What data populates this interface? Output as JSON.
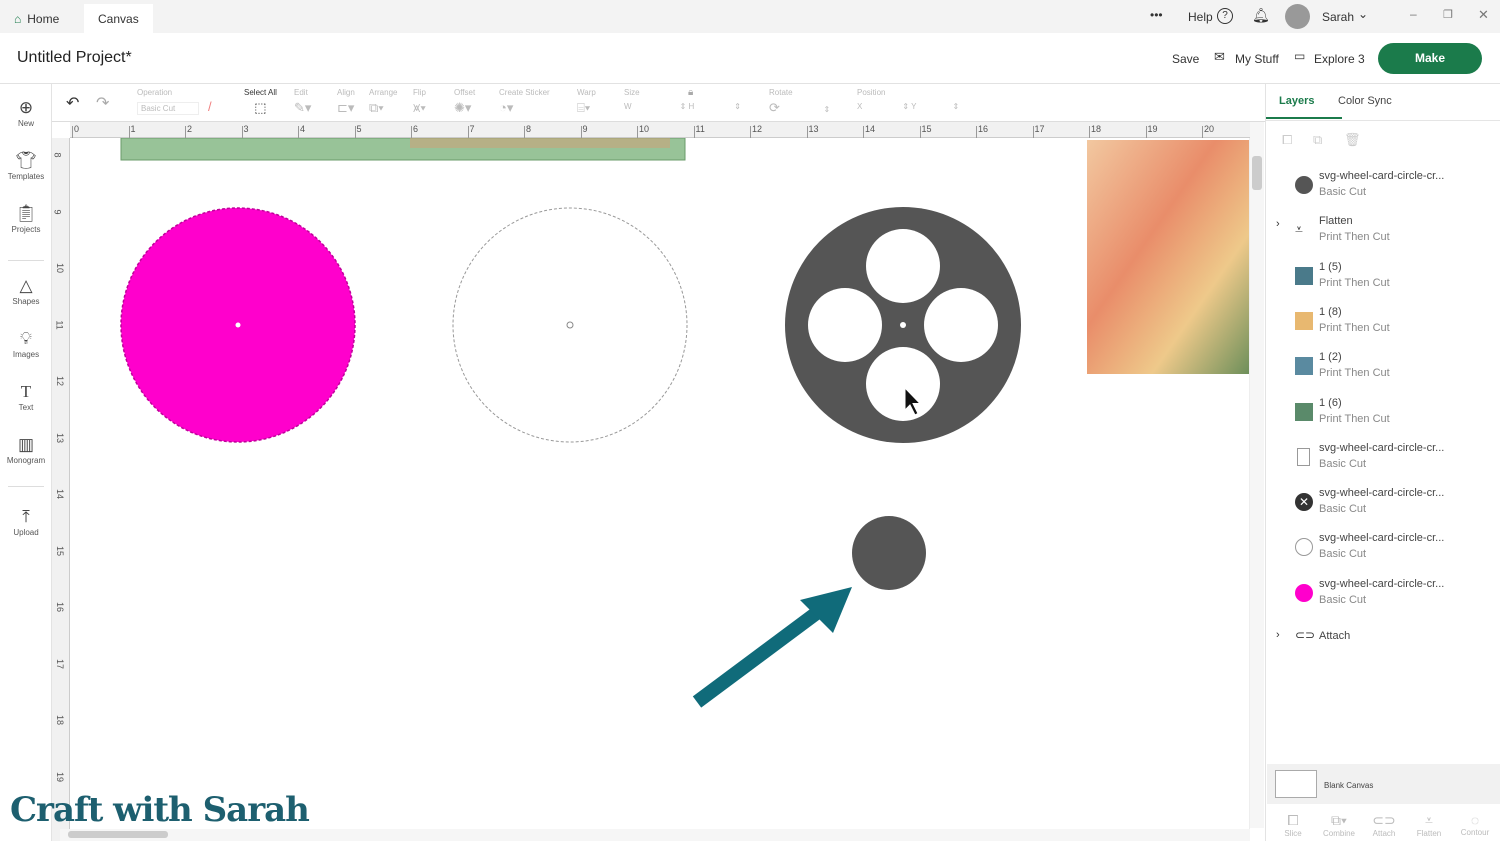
{
  "topbar": {
    "tabs": [
      {
        "label": "Home"
      },
      {
        "label": "Canvas"
      }
    ],
    "more": "•••",
    "help": "Help",
    "user": "Sarah"
  },
  "project": {
    "title": "Untitled Project*",
    "save": "Save",
    "my_stuff": "My Stuff",
    "machine": "Explore 3",
    "make": "Make"
  },
  "toolbar": {
    "operation_label": "Operation",
    "operation_value": "Basic Cut",
    "select_all": "Select All",
    "edit": "Edit",
    "align": "Align",
    "arrange": "Arrange",
    "flip": "Flip",
    "offset": "Offset",
    "create_sticker": "Create Sticker",
    "warp": "Warp",
    "size": "Size",
    "w": "W",
    "h": "H",
    "rotate": "Rotate",
    "position": "Position",
    "x": "X",
    "y": "Y"
  },
  "sidebar": {
    "items": [
      {
        "label": "New",
        "icon": "plus-circle-icon"
      },
      {
        "label": "Templates",
        "icon": "shirt-icon"
      },
      {
        "label": "Projects",
        "icon": "clipboard-icon"
      },
      {
        "label": "Shapes",
        "icon": "shapes-icon"
      },
      {
        "label": "Images",
        "icon": "bulb-icon"
      },
      {
        "label": "Text",
        "icon": "text-icon"
      },
      {
        "label": "Monogram",
        "icon": "monogram-icon"
      },
      {
        "label": "Upload",
        "icon": "upload-icon"
      }
    ]
  },
  "ruler": {
    "h": [
      "0",
      "1",
      "2",
      "3",
      "4",
      "5",
      "6",
      "7",
      "8",
      "9",
      "10",
      "11",
      "12",
      "13",
      "14",
      "15",
      "16",
      "17",
      "18",
      "19",
      "20"
    ],
    "v": [
      "8",
      "9",
      "10",
      "11",
      "12",
      "13",
      "14",
      "15",
      "16",
      "17",
      "18",
      "19"
    ]
  },
  "panel": {
    "tabs": [
      {
        "label": "Layers"
      },
      {
        "label": "Color Sync"
      }
    ],
    "layers": [
      {
        "name": "svg-wheel-card-circle-cr...",
        "op": "Basic Cut",
        "thumb": "#555555"
      },
      {
        "name": "Flatten",
        "op": "Print Then Cut",
        "thumb": "flatten",
        "group": true
      },
      {
        "name": "1 (5)",
        "op": "Print Then Cut",
        "thumb": "#4a7a8a"
      },
      {
        "name": "1 (8)",
        "op": "Print Then Cut",
        "thumb": "#e8b870"
      },
      {
        "name": "1 (2)",
        "op": "Print Then Cut",
        "thumb": "#5a8aa0"
      },
      {
        "name": "1 (6)",
        "op": "Print Then Cut",
        "thumb": "#5a8a6a"
      },
      {
        "name": "svg-wheel-card-circle-cr...",
        "op": "Basic Cut",
        "thumb": "rect"
      },
      {
        "name": "svg-wheel-card-circle-cr...",
        "op": "Basic Cut",
        "thumb": "wheel"
      },
      {
        "name": "svg-wheel-card-circle-cr...",
        "op": "Basic Cut",
        "thumb": "outline"
      },
      {
        "name": "svg-wheel-card-circle-cr...",
        "op": "Basic Cut",
        "thumb": "#ff00cc"
      }
    ],
    "attach": "Attach",
    "blank_canvas": "Blank Canvas",
    "bottom": [
      {
        "label": "Slice"
      },
      {
        "label": "Combine"
      },
      {
        "label": "Attach"
      },
      {
        "label": "Flatten"
      },
      {
        "label": "Contour"
      }
    ]
  },
  "watermark": "Craft with Sarah",
  "colors": {
    "make": "#1b7b4b",
    "pink": "#ff00cc",
    "dark": "#555555",
    "arrow": "#106b7a",
    "accent": "#1b7b4b"
  }
}
